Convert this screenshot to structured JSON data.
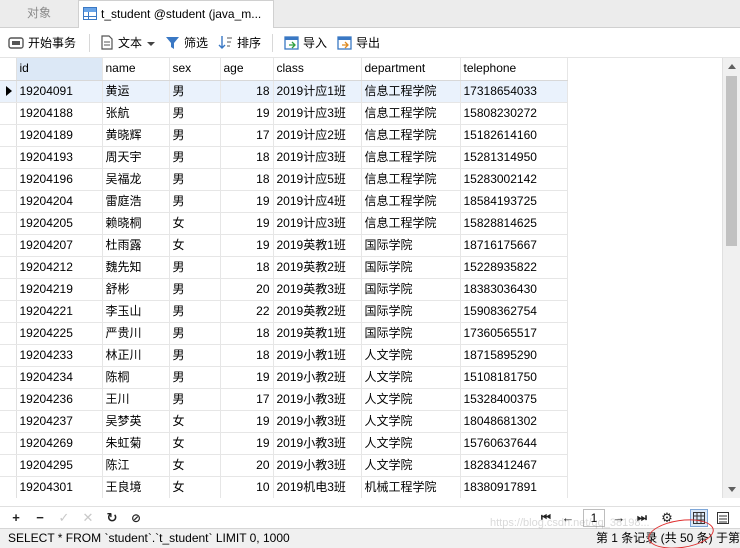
{
  "tabs": {
    "objects": "对象",
    "active": "t_student @student (java_m..."
  },
  "toolbar": {
    "begin_transaction": "开始事务",
    "text": "文本",
    "filter": "筛选",
    "sort": "排序",
    "import": "导入",
    "export": "导出"
  },
  "columns": [
    "id",
    "name",
    "sex",
    "age",
    "class",
    "department",
    "telephone"
  ],
  "rows": [
    [
      "19204091",
      "黄运",
      "男",
      "18",
      "2019计应1班",
      "信息工程学院",
      "17318654033"
    ],
    [
      "19204188",
      "张航",
      "男",
      "19",
      "2019计应3班",
      "信息工程学院",
      "15808230272"
    ],
    [
      "19204189",
      "黄晓辉",
      "男",
      "17",
      "2019计应2班",
      "信息工程学院",
      "15182614160"
    ],
    [
      "19204193",
      "周天宇",
      "男",
      "18",
      "2019计应3班",
      "信息工程学院",
      "15281314950"
    ],
    [
      "19204196",
      "吴福龙",
      "男",
      "18",
      "2019计应5班",
      "信息工程学院",
      "15283002142"
    ],
    [
      "19204204",
      "雷庭浩",
      "男",
      "19",
      "2019计应4班",
      "信息工程学院",
      "18584193725"
    ],
    [
      "19204205",
      "赖晓桐",
      "女",
      "19",
      "2019计应3班",
      "信息工程学院",
      "15828814625"
    ],
    [
      "19204207",
      "杜雨露",
      "女",
      "19",
      "2019英教1班",
      "国际学院",
      "18716175667"
    ],
    [
      "19204212",
      "魏先知",
      "男",
      "18",
      "2019英教2班",
      "国际学院",
      "15228935822"
    ],
    [
      "19204219",
      "舒彬",
      "男",
      "20",
      "2019英教3班",
      "国际学院",
      "18383036430"
    ],
    [
      "19204221",
      "李玉山",
      "男",
      "22",
      "2019英教2班",
      "国际学院",
      "15908362754"
    ],
    [
      "19204225",
      "严贵川",
      "男",
      "18",
      "2019英教1班",
      "国际学院",
      "17360565517"
    ],
    [
      "19204233",
      "林正川",
      "男",
      "18",
      "2019小教1班",
      "人文学院",
      "18715895290"
    ],
    [
      "19204234",
      "陈桐",
      "男",
      "19",
      "2019小教2班",
      "人文学院",
      "15108181750"
    ],
    [
      "19204236",
      "王川",
      "男",
      "17",
      "2019小教3班",
      "人文学院",
      "15328400375"
    ],
    [
      "19204237",
      "吴梦英",
      "女",
      "19",
      "2019小教3班",
      "人文学院",
      "18048681302"
    ],
    [
      "19204269",
      "朱虹菊",
      "女",
      "19",
      "2019小教3班",
      "人文学院",
      "15760637644"
    ],
    [
      "19204295",
      "陈江",
      "女",
      "20",
      "2019小教3班",
      "人文学院",
      "18283412467"
    ],
    [
      "19204301",
      "王良境",
      "女",
      "10",
      "2019机电3班",
      "机械工程学院",
      "18380917891"
    ]
  ],
  "bottom": {
    "page": "1"
  },
  "status": {
    "sql": "SELECT * FROM `student`.`t_student` LIMIT 0, 1000",
    "records": "第 1 条记录 (共 50 条) 于第",
    "watermark": "https://blog.csdn.net/qq_38198..."
  },
  "colors": {
    "selected_row": "#eaf2fc",
    "header_id": "#dce8f6",
    "circle": "#e03030",
    "icon_blue": "#3a78c4"
  }
}
